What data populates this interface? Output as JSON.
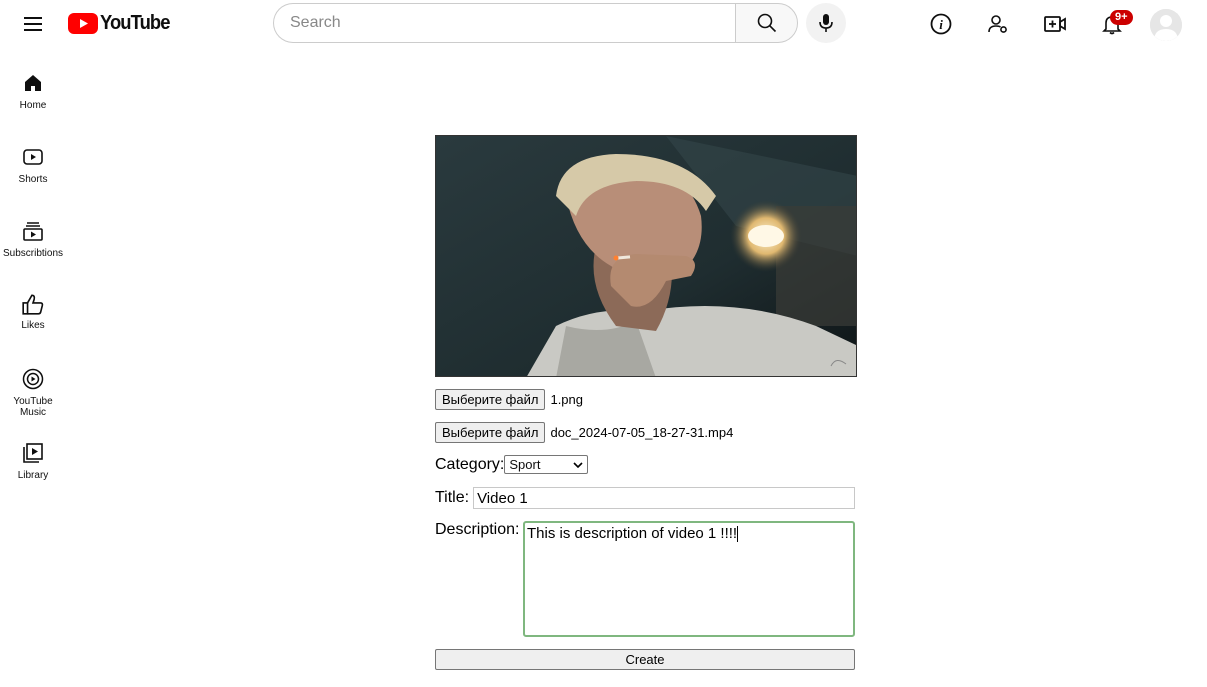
{
  "header": {
    "logo_text": "YouTube",
    "search_placeholder": "Search",
    "notification_badge": "9+"
  },
  "sidebar": {
    "items": [
      {
        "label": "Home",
        "icon": "home-icon"
      },
      {
        "label": "Shorts",
        "icon": "shorts-icon"
      },
      {
        "label": "Subscribtions",
        "icon": "subscriptions-icon"
      },
      {
        "label": "Likes",
        "icon": "thumbs-up-icon"
      },
      {
        "label": "YouTube Music",
        "icon": "music-icon"
      },
      {
        "label": "Library",
        "icon": "library-icon"
      }
    ]
  },
  "form": {
    "file_button_label": "Выберите файл",
    "thumbnail_file": "1.png",
    "video_file": "doc_2024-07-05_18-27-31.mp4",
    "category_label": "Category:",
    "category_value": "Sport",
    "title_label": "Title:",
    "title_value": "Video 1",
    "description_label": "Description:",
    "description_value": "This is description of video 1 !!!!",
    "create_label": "Create"
  },
  "colors": {
    "brand_red": "#ff0000",
    "badge_red": "#cc0000",
    "focus_green": "#7fb77f"
  }
}
